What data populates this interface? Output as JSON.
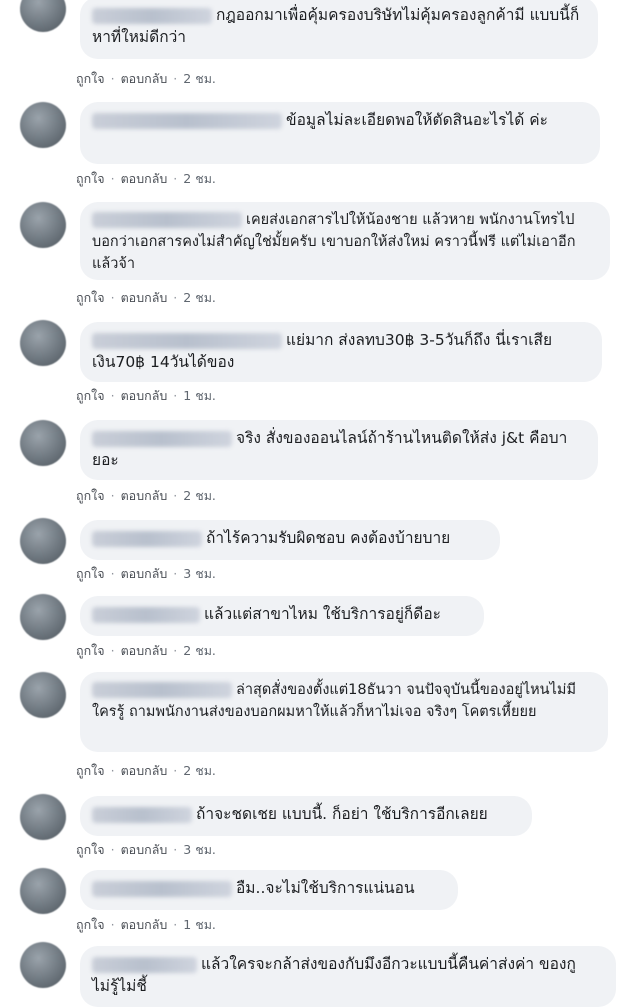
{
  "actions": {
    "like": "ถูกใจ",
    "reply": "ตอบกลับ",
    "separator": "·"
  },
  "comments": [
    {
      "text": "กฎออกมาเพื่อคุ้มครองบริษัทไม่คุ้มครองลูกค้ามี แบบนี้ก็หาที่ใหม่ดีกว่า",
      "time": "2 ชม."
    },
    {
      "text": "ข้อมูลไม่ละเอียดพอให้ตัดสินอะไรได้ ค่ะ",
      "time": "2 ชม."
    },
    {
      "text": "เคยส่งเอกสารไปให้น้องชาย แล้วหาย พนักงานโทรไปบอกว่าเอกสารคงไม่สำคัญใช่มั้ยครับ เขาบอกให้ส่งใหม่ คราวนี้ฟรี แต่ไม่เอาอีกแล้วจ้า",
      "time": "2 ชม."
    },
    {
      "text": "แย่มาก ส่งลทบ30฿ 3-5วันก็ถึง นี่เราเสีย เงิน70฿ 14วันได้ของ",
      "time": "1 ชม."
    },
    {
      "text": "จริง สั่งของออนไลน์ถ้าร้านไหนติดให้ส่ง j&t คือบายอะ",
      "time": "2 ชม."
    },
    {
      "text": "ถ้าไร้ความรับผิดชอบ คงต้องบ้ายบาย",
      "time": "3 ชม."
    },
    {
      "text": "แล้วแต่สาขาไหม ใช้บริการอยู่ก็ดีอะ",
      "time": "2 ชม."
    },
    {
      "text": "ล่าสุดสั่งของตั้งแต่18ธันวา จนปัจจุบันนี้ของอยู่ไหนไม่มีใครรู้ ถามพนักงานส่งของบอกผมหาให้แล้วก็หาไม่เจอ จริงๆ โคตรเหี้ยยย",
      "time": "2 ชม."
    },
    {
      "text": "ถ้าจะชดเชย แบบนี้. ก็อย่า ใช้บริการอีกเลยย",
      "time": "3 ชม."
    },
    {
      "text": "อืม..จะไม่ใช้บริการแน่นอน",
      "time": "1 ชม."
    },
    {
      "text": "แล้วใครจะกล้าส่งของกับมึงอีกวะแบบนี้คืนค่าส่งค่า ของกูไม่รู้ไม่ชี้",
      "time": ""
    }
  ]
}
